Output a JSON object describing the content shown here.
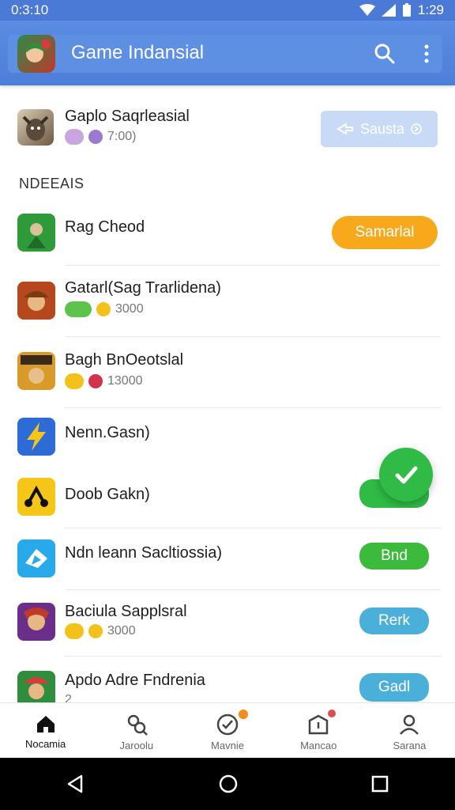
{
  "status_bar": {
    "time": "0:3:10",
    "clock": "1:29"
  },
  "app_bar": {
    "title": "Game Indansial"
  },
  "featured": {
    "title": "Gaplo Saqrleasial",
    "rating": "7:00)",
    "button_label": "Sausta"
  },
  "section": {
    "title": "NDEEAIS"
  },
  "games": [
    {
      "title": "Rag Cheod",
      "meta": "",
      "button": "Samarlal",
      "button_color": "#f7a81b"
    },
    {
      "title": "Gatarl(Sag Trarlidena)",
      "meta": "3000",
      "button": "",
      "button_color": ""
    },
    {
      "title": "Bagh BnOeotslal",
      "meta": "13000",
      "button": "",
      "button_color": ""
    },
    {
      "title": "Nenn.Gasn)",
      "meta": "",
      "button": "",
      "button_color": ""
    },
    {
      "title": "Doob Gakn)",
      "meta": "",
      "button": "",
      "button_color": "#2fbb45"
    },
    {
      "title": "Ndn leann Sacltiossia)",
      "meta": "",
      "button": "Bnd",
      "button_color": "#3cba3c"
    },
    {
      "title": "Baciula Sapplsral",
      "meta": "3000",
      "button": "Rerk",
      "button_color": "#4bb0d9"
    },
    {
      "title": "Apdo Adre Fndrenia",
      "meta": "2",
      "button": "Gadl",
      "button_color": "#4bb0d9"
    }
  ],
  "bottom_nav": [
    {
      "label": "Nocamia",
      "icon": "home-icon"
    },
    {
      "label": "Jaroolu",
      "icon": "search-people-icon"
    },
    {
      "label": "Mavnie",
      "icon": "check-circle-icon"
    },
    {
      "label": "Mancao",
      "icon": "notification-box-icon"
    },
    {
      "label": "Sarana",
      "icon": "profile-icon"
    }
  ],
  "colors": {
    "primary": "#4d7fd9",
    "accent_orange": "#f7a81b",
    "accent_green": "#2fbb45",
    "accent_blue": "#4bb0d9"
  }
}
